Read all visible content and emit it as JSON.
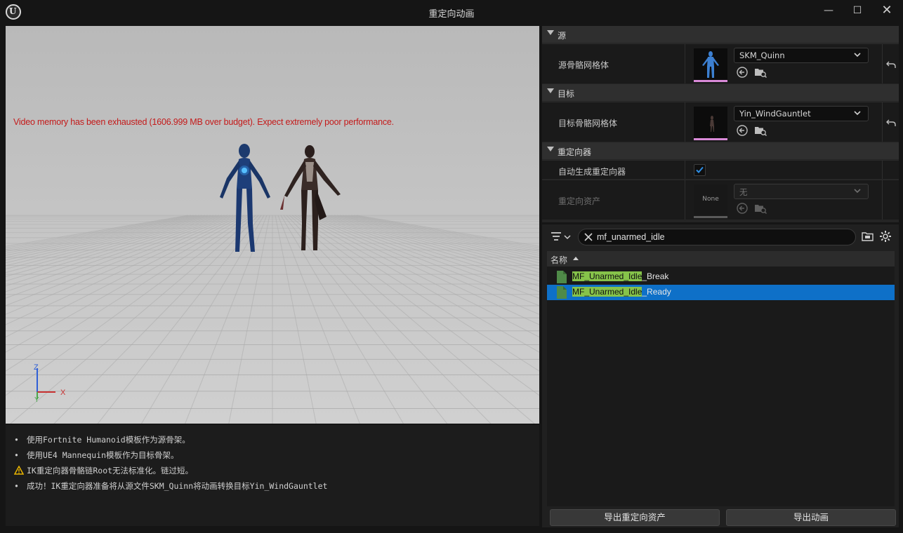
{
  "window": {
    "title": "重定向动画",
    "min_glyph": "—",
    "max_glyph": "☐",
    "close_glyph": "✕"
  },
  "viewport": {
    "warning": "Video memory has been exhausted (1606.999 MB over budget). Expect extremely poor performance.",
    "axis_z": "Z",
    "axis_x": "X",
    "axis_y": "Y",
    "warning_color": "#c41a1a"
  },
  "log": [
    {
      "type": "bullet",
      "text": "使用Fortnite Humanoid模板作为源骨架。"
    },
    {
      "type": "bullet",
      "text": "使用UE4 Mannequin模板作为目标骨架。"
    },
    {
      "type": "warning",
      "text": "IK重定向器骨骼链Root无法标准化。链过短。"
    },
    {
      "type": "bullet",
      "text": "成功！IK重定向器准备将从源文件SKM_Quinn将动画转换目标Yin_WindGauntlet"
    }
  ],
  "details": {
    "source_category": "源",
    "source_mesh_label": "源骨骼网格体",
    "source_mesh_value": "SKM_Quinn",
    "target_category": "目标",
    "target_mesh_label": "目标骨骼网格体",
    "target_mesh_value": "Yin_WindGauntlet",
    "retargeter_category": "重定向器",
    "auto_generate_label": "自动生成重定向器",
    "auto_generate_checked": true,
    "retarget_asset_label": "重定向资产",
    "retarget_asset_value": "无",
    "retarget_asset_thumb": "None"
  },
  "asset_browser": {
    "search_value": "mf_unarmed_idle",
    "column_name": "名称",
    "items": [
      {
        "highlight": "MF_Unarmed_Idle",
        "rest": "_Break",
        "selected": false
      },
      {
        "highlight": "MF_Unarmed_Idle",
        "rest": "_Ready",
        "selected": true
      }
    ],
    "highlight_color": "#86c34a",
    "selection_color": "#0e70c8"
  },
  "buttons": {
    "export_retarget_asset": "导出重定向资产",
    "export_animation": "导出动画"
  }
}
